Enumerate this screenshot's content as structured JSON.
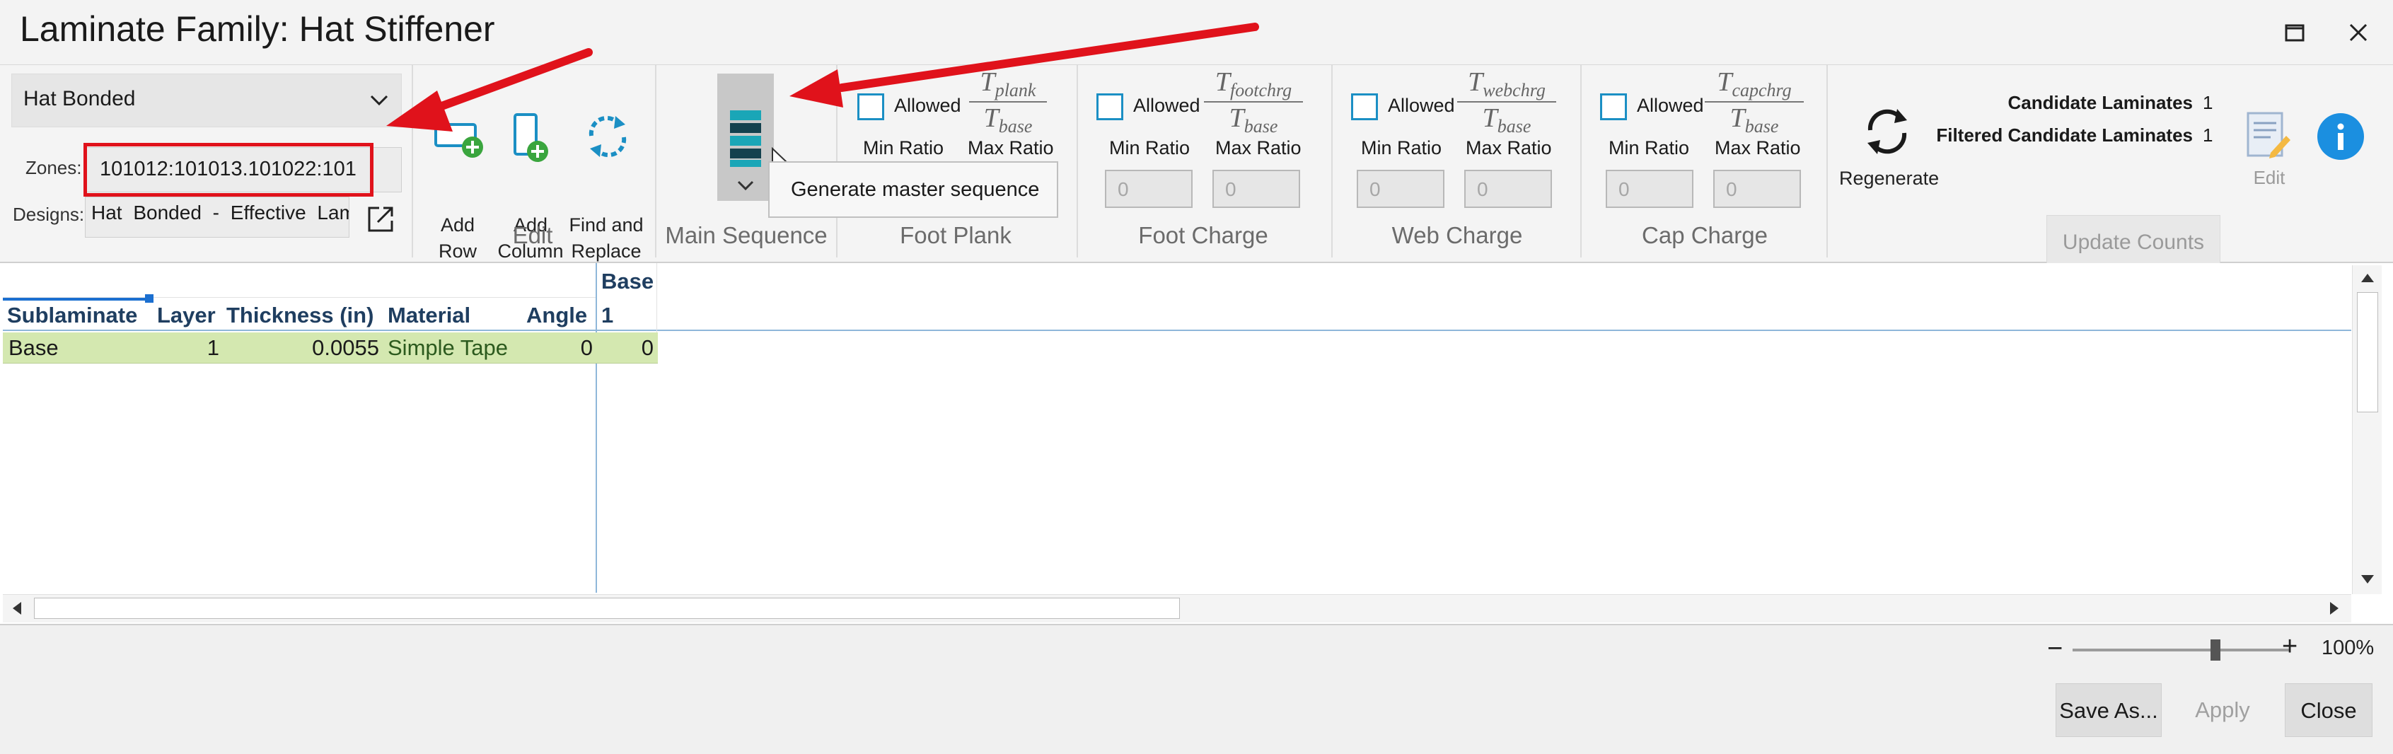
{
  "window": {
    "title": "Laminate Family: Hat Stiffener",
    "maximize_icon": "maximize-icon",
    "close_icon": "close-icon"
  },
  "family_group": {
    "type_value": "Hat Bonded",
    "zones_label": "Zones:",
    "zones_value": "101012:101013.101022:101",
    "designs_label": "Designs:",
    "designs_value": "Hat Bonded - Effective Laminate"
  },
  "edit_group": {
    "label": "Edit",
    "add_row": [
      "Add",
      "Row"
    ],
    "add_column": [
      "Add",
      "Column"
    ],
    "find_replace": [
      "Find and",
      "Replace"
    ]
  },
  "main_sequence_group": {
    "label": "Main Sequence",
    "tooltip": "Generate master sequence"
  },
  "ratio_groups": [
    {
      "label": "Foot Plank",
      "allowed": "Allowed",
      "min": "Min Ratio",
      "max": "Max Ratio",
      "num": "T",
      "num_sub": "plank",
      "den": "T",
      "den_sub": "base",
      "min_value": "",
      "max_value": ""
    },
    {
      "label": "Foot Charge",
      "allowed": "Allowed",
      "min": "Min Ratio",
      "max": "Max Ratio",
      "num": "T",
      "num_sub": "footchrg",
      "den": "T",
      "den_sub": "base",
      "min_value": "0",
      "max_value": "0"
    },
    {
      "label": "Web Charge",
      "allowed": "Allowed",
      "min": "Min Ratio",
      "max": "Max Ratio",
      "num": "T",
      "num_sub": "webchrg",
      "den": "T",
      "den_sub": "base",
      "min_value": "0",
      "max_value": "0"
    },
    {
      "label": "Cap Charge",
      "allowed": "Allowed",
      "min": "Min Ratio",
      "max": "Max Ratio",
      "num": "T",
      "num_sub": "capchrg",
      "den": "T",
      "den_sub": "base",
      "min_value": "0",
      "max_value": "0"
    }
  ],
  "regen_group": {
    "regenerate": "Regenerate",
    "candidate_label": "Candidate Laminates",
    "candidate_value": "1",
    "filtered_label": "Filtered Candidate Laminates",
    "filtered_value": "1",
    "update_counts": "Update Counts",
    "edit": "Edit"
  },
  "grid": {
    "group_header": "Base",
    "columns": [
      "Sublaminate",
      "Layer",
      "Thickness (in)",
      "Material",
      "Angle",
      "1"
    ],
    "rows": [
      [
        "Base",
        "1",
        "0.0055",
        "Simple Tape",
        "0",
        "0"
      ]
    ],
    "row_color": "#d4e8b0"
  },
  "zoom": {
    "minus": "−",
    "plus": "+",
    "level": "100%",
    "fraction": 0.66
  },
  "footer": {
    "save_as": "Save As...",
    "apply": "Apply",
    "close": "Close"
  },
  "colors": {
    "accent": "#1b8fc4",
    "highlight_red": "#e0121b",
    "header_text": "#1f3e60"
  }
}
